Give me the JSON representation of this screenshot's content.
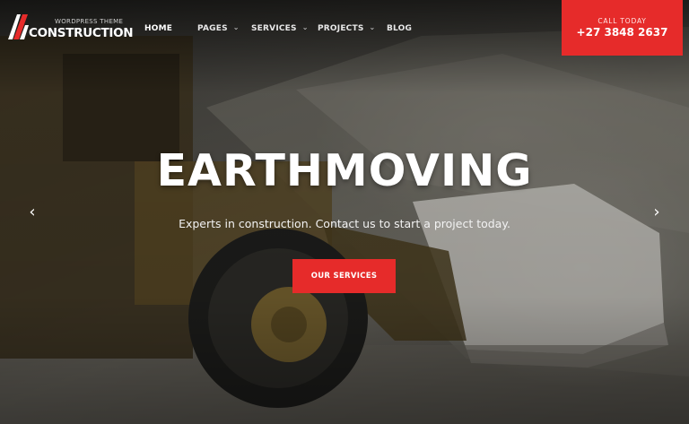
{
  "brand": {
    "tagline": "WORDPRESS THEME",
    "name": "CONSTRUCTION"
  },
  "nav": {
    "items": [
      {
        "label": "HOME",
        "active": true,
        "has_dropdown": false
      },
      {
        "label": "PAGES",
        "active": false,
        "has_dropdown": true
      },
      {
        "label": "SERVICES",
        "active": false,
        "has_dropdown": true
      },
      {
        "label": "PROJECTS",
        "active": false,
        "has_dropdown": true
      },
      {
        "label": "BLOG",
        "active": false,
        "has_dropdown": false
      }
    ]
  },
  "call": {
    "label": "CALL TODAY",
    "phone": "+27 3848 2637"
  },
  "hero": {
    "title": "EARTHMOVING",
    "subtitle": "Experts in construction. Contact us to start a project today.",
    "cta_label": "OUR SERVICES",
    "prev_icon": "chevron-left-icon",
    "next_icon": "chevron-right-icon",
    "prev_glyph": "‹",
    "next_glyph": "›"
  },
  "colors": {
    "accent": "#e62b2a",
    "text": "#ffffff"
  }
}
